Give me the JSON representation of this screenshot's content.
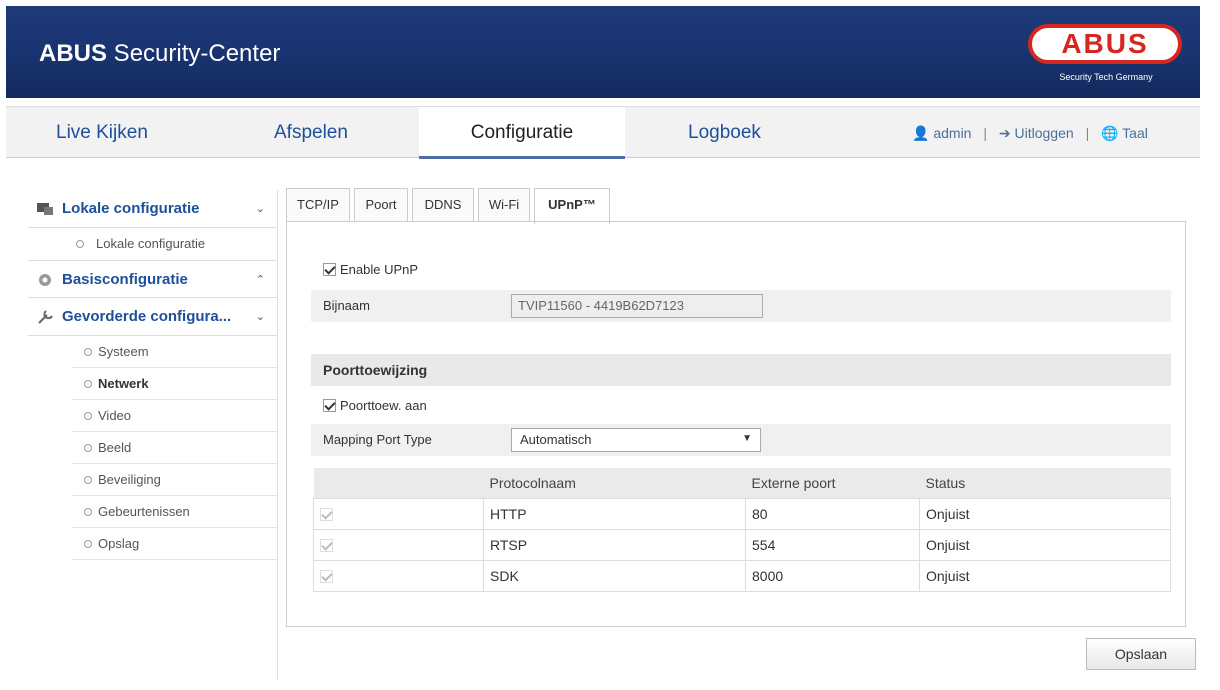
{
  "header": {
    "title_bold": "ABUS",
    "title_rest": " Security-Center",
    "logo_text": "ABUS",
    "logo_tagline": "Security Tech Germany"
  },
  "nav": {
    "tabs": [
      {
        "label": "Live Kijken"
      },
      {
        "label": "Afspelen"
      },
      {
        "label": "Configuratie"
      },
      {
        "label": "Logboek"
      }
    ],
    "user": "admin",
    "logout": "Uitloggen",
    "language": "Taal"
  },
  "sidebar": {
    "local_head": "Lokale configuratie",
    "local_sub": "Lokale configuratie",
    "basic_head": "Basisconfiguratie",
    "adv_head": "Gevorderde configura...",
    "adv_items": [
      "Systeem",
      "Netwerk",
      "Video",
      "Beeld",
      "Beveiliging",
      "Gebeurtenissen",
      "Opslag"
    ]
  },
  "tabs": [
    "TCP/IP",
    "Poort",
    "DDNS",
    "Wi-Fi",
    "UPnP™"
  ],
  "form": {
    "enable_upnp": "Enable UPnP",
    "alias_label": "Bijnaam",
    "alias_value": "TVIP11560 - 4419B62D7123",
    "section_title": "Poorttoewijzing",
    "port_enable": "Poorttoew. aan",
    "mapping_label": "Mapping Port Type",
    "mapping_value": "Automatisch"
  },
  "table": {
    "headers": [
      "",
      "Protocolnaam",
      "Externe poort",
      "Status"
    ],
    "rows": [
      {
        "protocol": "HTTP",
        "port": "80",
        "status": "Onjuist"
      },
      {
        "protocol": "RTSP",
        "port": "554",
        "status": "Onjuist"
      },
      {
        "protocol": "SDK",
        "port": "8000",
        "status": "Onjuist"
      }
    ]
  },
  "save_label": "Opslaan"
}
